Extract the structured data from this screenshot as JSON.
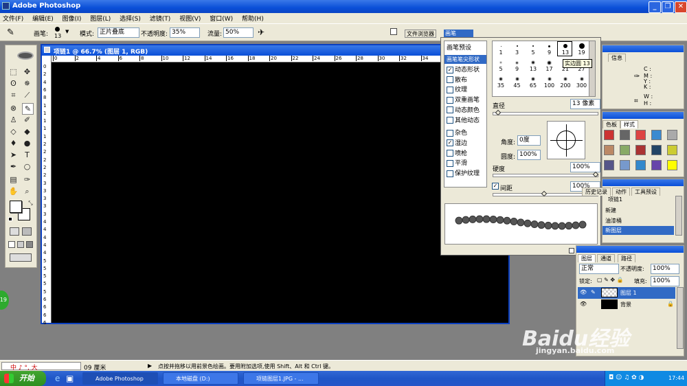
{
  "app": {
    "title": "Adobe Photoshop"
  },
  "menu": [
    "文件(F)",
    "编辑(E)",
    "图像(I)",
    "图层(L)",
    "选择(S)",
    "滤镜(T)",
    "视图(V)",
    "窗口(W)",
    "帮助(H)"
  ],
  "options": {
    "brush_label": "画笔:",
    "brush_size": "13",
    "mode_label": "模式:",
    "mode_value": "正片叠底",
    "opacity_label": "不透明度:",
    "opacity_value": "35%",
    "flow_label": "流量:",
    "flow_value": "50%",
    "tab_file_browser": "文件浏览器",
    "tab_brushes": "画笔"
  },
  "document": {
    "title": "项链1 @ 66.7% (图层 1, RGB)",
    "ruler_h": [
      "0",
      "2",
      "4",
      "6",
      "8",
      "10",
      "12",
      "14",
      "16",
      "18",
      "20",
      "22",
      "24",
      "26",
      "28",
      "30",
      "32",
      "34",
      "36",
      "38",
      "40"
    ],
    "ruler_v": [
      "0",
      "2",
      "4",
      "6",
      "8",
      "1",
      "1",
      "1",
      "1",
      "1",
      "2",
      "2",
      "2",
      "2",
      "2",
      "3",
      "3",
      "3",
      "3",
      "3",
      "4",
      "4",
      "4",
      "4",
      "4",
      "5",
      "5",
      "5",
      "5",
      "5",
      "6",
      "6",
      "6",
      "6"
    ]
  },
  "brush_panel": {
    "presets": "画笔预设",
    "tip_shape": "画笔笔尖形状",
    "options": [
      {
        "label": "动态形状",
        "checked": true
      },
      {
        "label": "散布",
        "checked": false
      },
      {
        "label": "纹理",
        "checked": false
      },
      {
        "label": "双重画笔",
        "checked": false
      },
      {
        "label": "动态颜色",
        "checked": false
      },
      {
        "label": "其他动态",
        "checked": false
      },
      {
        "label": "杂色",
        "checked": false
      },
      {
        "label": "湿边",
        "checked": true
      },
      {
        "label": "喷枪",
        "checked": false
      },
      {
        "label": "平滑",
        "checked": false
      },
      {
        "label": "保护纹理",
        "checked": false
      }
    ],
    "tips_row1": [
      "1",
      "3",
      "5",
      "9",
      "13",
      "19"
    ],
    "tips_row2": [
      "5",
      "9",
      "13",
      "17",
      "21",
      "27"
    ],
    "tips_row3": [
      "35",
      "45",
      "65",
      "100",
      "200",
      "300"
    ],
    "tooltip": "实边圆 13",
    "diameter_label": "直径",
    "diameter_value": "13 像素",
    "angle_label": "角度:",
    "angle_value": "0度",
    "roundness_label": "圆度:",
    "roundness_value": "100%",
    "hardness_label": "硬度",
    "hardness_value": "100%",
    "spacing_label": "间距",
    "spacing_value": "100%"
  },
  "info_panel": {
    "tab": "信息",
    "c": "C :",
    "m": "M :",
    "y": "Y :",
    "k": "K :",
    "w": "W :",
    "h": "H :"
  },
  "styles_panel": {
    "tab_color": "色板",
    "tab_styles": "样式"
  },
  "history_panel": {
    "tab_history": "历史记录",
    "tab_actions": "动作",
    "tab_presets": "工具预设",
    "snapshot": "项链1",
    "items": [
      "新建",
      "油漆桶",
      "新图层"
    ]
  },
  "layers_panel": {
    "tab_layers": "图层",
    "tab_channels": "通道",
    "tab_paths": "路径",
    "blend": "正常",
    "opacity_label": "不透明度:",
    "opacity": "100%",
    "lock_label": "锁定:",
    "fill_label": "填充:",
    "fill": "100%",
    "layers": [
      "图层 1",
      "背景"
    ]
  },
  "status": {
    "zoom": "66.67%",
    "doc": "09 厘米",
    "message": "点按并拖移以用前景色绘画。要用附加选项,使用 Shift、Alt 和 Ctrl 键。",
    "ime": "中 ♪ °, 大"
  },
  "taskbar": {
    "start": "开始",
    "items": [
      "Adobe Photoshop",
      "本地磁盘 (D:)",
      "项链图层1.JPG - ..."
    ],
    "clock": "17:44"
  },
  "watermark": {
    "brand": "Baidu经验",
    "url": "jingyan.baidu.com"
  },
  "badge": "19",
  "colors": {
    "titlebar": "#0a4fd8",
    "panel_bg": "#ece9d8",
    "canvas": "#000000",
    "highlight": "#316ac5"
  }
}
